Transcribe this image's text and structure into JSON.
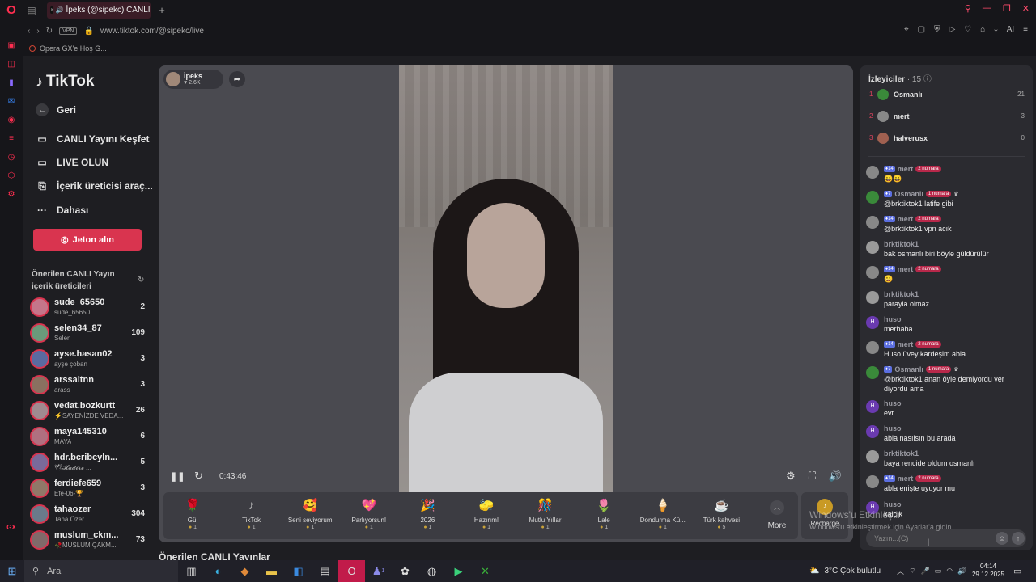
{
  "browser": {
    "tab_title": "İpeks (@sipekc) CANLI",
    "url": "www.tiktok.com/@sipekc/live",
    "vpn_label": "VPN",
    "bookmark": "Opera GX'e Hoş G...",
    "sidebar_bottom_label": "GX",
    "address_ai_label": "AI"
  },
  "nav": {
    "logo": "TikTok",
    "items": [
      {
        "label": "Geri",
        "icon": "back-arrow-icon"
      },
      {
        "label": "CANLI Yayını Keşfet",
        "icon": "tv-icon"
      },
      {
        "label": "LIVE OLUN",
        "icon": "video-camera-icon"
      },
      {
        "label": "İçerik üreticisi araç...",
        "icon": "creator-tools-icon"
      },
      {
        "label": "Dahası",
        "icon": "more-dots-icon"
      }
    ],
    "coins_button": "Jeton alın",
    "suggested_title": "Önerilen CANLI Yayın içerik üreticileri"
  },
  "suggested": [
    {
      "name": "sude_65650",
      "sub": "sude_65650",
      "count": "2",
      "color": "#c4768a"
    },
    {
      "name": "selen34_87",
      "sub": "Selen",
      "count": "109",
      "color": "#6a9a7a"
    },
    {
      "name": "ayse.hasan02",
      "sub": "ayşe çoban",
      "count": "3",
      "color": "#5a6aa0"
    },
    {
      "name": "arssaltnn",
      "sub": "arass",
      "count": "3",
      "color": "#8a7060"
    },
    {
      "name": "vedat.bozkurtt",
      "sub": "⚡SAYENİZDE VEDA...",
      "count": "26",
      "color": "#a08a90"
    },
    {
      "name": "maya145310",
      "sub": "MAYA",
      "count": "6",
      "color": "#b07080"
    },
    {
      "name": "hdr.bcribcyln...",
      "sub": "🕊𝓗𝓪𝓭𝓲𝓻𝓮 ...",
      "count": "5",
      "color": "#7a6a9a"
    },
    {
      "name": "ferdiefe659",
      "sub": "Efe-06-🏆",
      "count": "3",
      "color": "#907868"
    },
    {
      "name": "tahaozer",
      "sub": "Taha Özer",
      "count": "304",
      "color": "#6a7a8a"
    },
    {
      "name": "muslum_ckm...",
      "sub": "🥀MÜSLÜM ÇAKM...",
      "count": "73",
      "color": "#806a6a"
    }
  ],
  "player": {
    "streamer": "İpeks",
    "likes": "2.6K",
    "time": "0:43:46"
  },
  "gifts": [
    {
      "name": "Gül",
      "price": "1",
      "glyph": "🌹"
    },
    {
      "name": "TikTok",
      "price": "1",
      "glyph": "♪"
    },
    {
      "name": "Seni seviyorum",
      "price": "1",
      "glyph": "🥰"
    },
    {
      "name": "Parlıyorsun!",
      "price": "1",
      "glyph": "💖"
    },
    {
      "name": "2026",
      "price": "1",
      "glyph": "🎉"
    },
    {
      "name": "Hazırım!",
      "price": "1",
      "glyph": "🧽"
    },
    {
      "name": "Mutlu Yıllar",
      "price": "1",
      "glyph": "🎊"
    },
    {
      "name": "Lale",
      "price": "1",
      "glyph": "🌷"
    },
    {
      "name": "Dondurma Kü...",
      "price": "1",
      "glyph": "🍦"
    },
    {
      "name": "Türk kahvesi",
      "price": "5",
      "glyph": "☕"
    }
  ],
  "gift_more": "More",
  "recharge": "Recharge",
  "suggested_live_title": "Önerilen CANLI Yayınlar",
  "chat": {
    "viewers_title": "İzleyiciler",
    "viewers_count": "· 15",
    "top_viewers": [
      {
        "rank": "1",
        "name": "Osmanlı",
        "score": "21",
        "color": "#3a8a3a"
      },
      {
        "rank": "2",
        "name": "mert",
        "score": "3",
        "color": "#888888"
      },
      {
        "rank": "3",
        "name": "halverusx",
        "score": "0",
        "color": "#a06050"
      }
    ],
    "messages": [
      {
        "level": "14",
        "name": "mert",
        "fan": "2 numara",
        "text": "😀😀",
        "avatar": "#888888",
        "initial": ""
      },
      {
        "level": "7",
        "name": "Osmanlı",
        "fan": "1 numara",
        "crown": "♛",
        "text": "@brktiktok1 latife gibi",
        "avatar": "#3a8a3a",
        "initial": ""
      },
      {
        "level": "14",
        "name": "mert",
        "fan": "2 numara",
        "text": "@brktiktok1 vpn acık",
        "avatar": "#888888",
        "initial": ""
      },
      {
        "name": "brktiktok1",
        "text": "bak osmanlı biri böyle güldürülür",
        "avatar": "#9a9a9a",
        "initial": ""
      },
      {
        "level": "14",
        "name": "mert",
        "fan": "2 numara",
        "text": "😀",
        "avatar": "#888888",
        "initial": ""
      },
      {
        "name": "brktiktok1",
        "text": "parayla olmaz",
        "avatar": "#9a9a9a",
        "initial": ""
      },
      {
        "name": "huso",
        "text": "merhaba",
        "avatar": "#6a3ab0",
        "initial": "H"
      },
      {
        "level": "14",
        "name": "mert",
        "fan": "2 numara",
        "text": "Huso üvey kardeşim abla",
        "avatar": "#888888",
        "initial": ""
      },
      {
        "level": "7",
        "name": "Osmanlı",
        "fan": "1 numara",
        "crown": "♛",
        "text": "@brktiktok1 anan öyle demiyordu ver diyordu ama",
        "avatar": "#3a8a3a",
        "initial": ""
      },
      {
        "name": "huso",
        "text": "evt",
        "avatar": "#6a3ab0",
        "initial": "H"
      },
      {
        "name": "huso",
        "text": "abla nasılsın bu arada",
        "avatar": "#6a3ab0",
        "initial": "H"
      },
      {
        "name": "brktiktok1",
        "text": "baya rencide oldum osmanlı",
        "avatar": "#9a9a9a",
        "initial": ""
      },
      {
        "level": "14",
        "name": "mert",
        "fan": "2 numara",
        "text": "abla enişte uyuyor mu",
        "avatar": "#888888",
        "initial": ""
      },
      {
        "name": "huso",
        "text": "kalcık",
        "avatar": "#6a3ab0",
        "initial": "H"
      }
    ],
    "input_placeholder": "Yazın...(C)"
  },
  "windows_watermark": {
    "line1": "Windows'u Etkinleştir",
    "line2": "Windows'u etkinleştirmek için Ayarlar'a gidin."
  },
  "taskbar": {
    "search": "Ara",
    "weather": "3°C  Çok bulutlu",
    "time": "04:14",
    "date": "29.12.2025",
    "badge_count": "1"
  },
  "colors": {
    "accent": "#d9344f",
    "opera_red": "#ff2e50"
  }
}
